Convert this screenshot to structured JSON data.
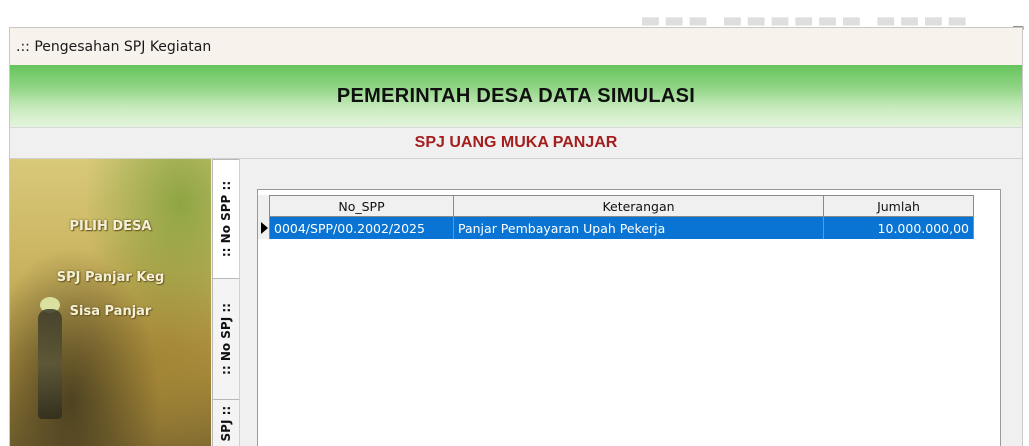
{
  "background": {
    "fragment_digit": "5"
  },
  "window": {
    "title": ".:: Pengesahan SPJ Kegiatan"
  },
  "header": {
    "title": "PEMERINTAH DESA DATA SIMULASI"
  },
  "subheader": {
    "title": "SPJ UANG MUKA PANJAR"
  },
  "side_menu": {
    "items": [
      {
        "label": "PILIH DESA"
      },
      {
        "label": "SPJ Panjar Keg"
      },
      {
        "label": "Sisa Panjar"
      }
    ]
  },
  "tabs": [
    {
      "label": ":: No SPP ::"
    },
    {
      "label": ":: No SPJ ::"
    },
    {
      "label": "n SPJ ::"
    }
  ],
  "grid": {
    "columns": [
      "No_SPP",
      "Keterangan",
      "Jumlah"
    ],
    "rows": [
      {
        "no_spp": "0004/SPP/00.2002/2025",
        "keterangan": "Panjar Pembayaran Upah Pekerja",
        "jumlah": "10.000.000,00"
      }
    ]
  },
  "colors": {
    "header_green": "#66c45b",
    "subheader_red": "#a41e1e",
    "selection_blue": "#0a74d4"
  }
}
